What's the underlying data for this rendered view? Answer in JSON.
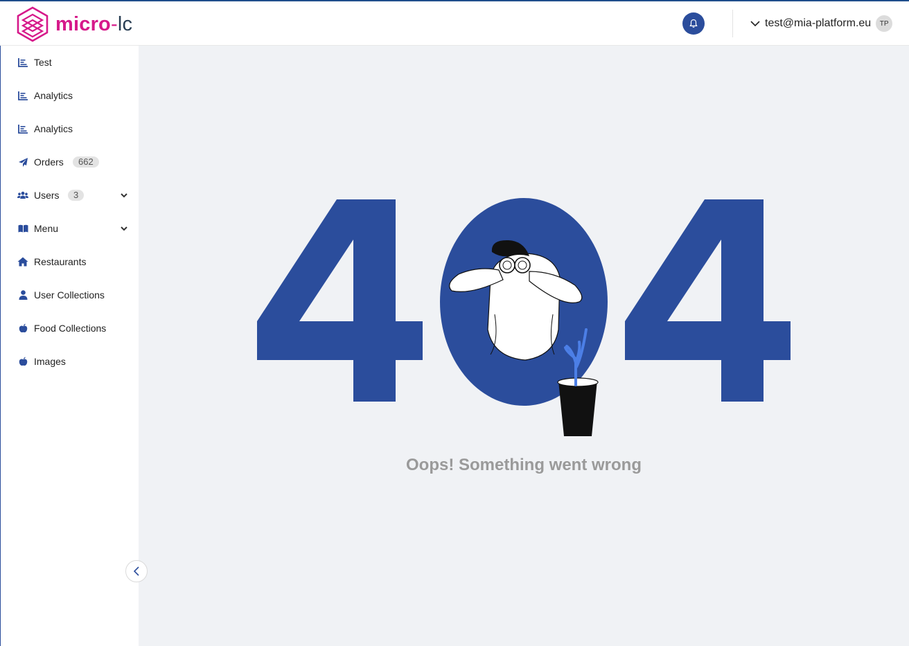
{
  "app": {
    "logo_primary": "micro",
    "logo_dash": "-",
    "logo_secondary": "lc",
    "brand_color": "#d6198a",
    "accent_color": "#2b4d9c"
  },
  "header": {
    "notification_icon": "bell-icon",
    "user_email": "test@mia-platform.eu",
    "avatar_initials": "TP",
    "dropdown_icon": "chevron-down-icon"
  },
  "sidebar": {
    "items": [
      {
        "label": "Test",
        "icon": "bar-chart-icon"
      },
      {
        "label": "Analytics",
        "icon": "bar-chart-icon"
      },
      {
        "label": "Analytics",
        "icon": "bar-chart-icon"
      },
      {
        "label": "Orders",
        "icon": "paper-plane-icon",
        "badge": "662"
      },
      {
        "label": "Users",
        "icon": "users-icon",
        "badge": "3",
        "expandable": true
      },
      {
        "label": "Menu",
        "icon": "book-icon",
        "expandable": true
      },
      {
        "label": "Restaurants",
        "icon": "home-icon"
      },
      {
        "label": "User Collections",
        "icon": "user-icon"
      },
      {
        "label": "Food Collections",
        "icon": "apple-icon"
      },
      {
        "label": "Images",
        "icon": "apple-icon"
      }
    ],
    "collapse_icon": "chevron-left-icon"
  },
  "main": {
    "error_code": "404",
    "error_message": "Oops! Something went wrong"
  }
}
